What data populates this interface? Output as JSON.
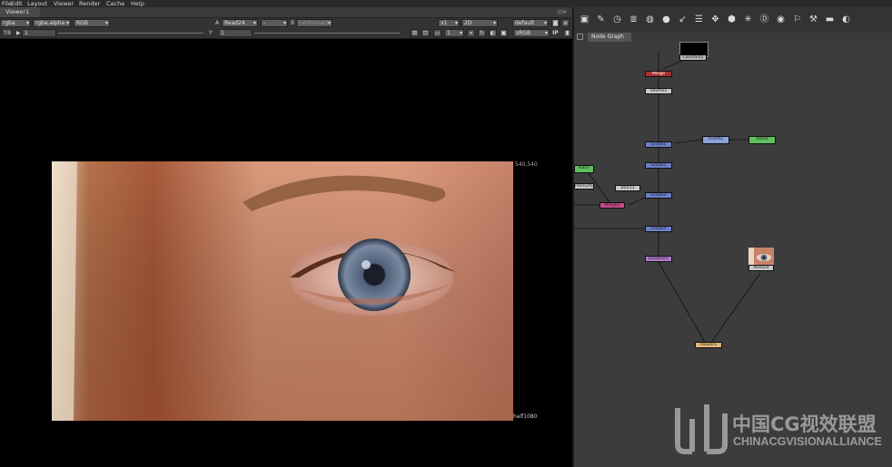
{
  "menu": {
    "items": [
      "File",
      "Edit",
      "Layout",
      "Viewer",
      "Render",
      "Cache",
      "Help"
    ]
  },
  "viewer": {
    "tab_label": "Viewer1",
    "channels_value": "rgba",
    "layer_value": "rgba.alpha",
    "display_channels_value": "RGB",
    "a_label": "A",
    "a_input_value": "Read24",
    "b_input_value": "-",
    "b_label": "B",
    "b_format_value": "(unformat)",
    "zoom_value": "x1",
    "view_mode_value": "2D",
    "lut_value": "default",
    "fstop_label": "f/8",
    "gain_value": "1",
    "y_label": "Y",
    "gamma_value": "1",
    "frame_value": "1",
    "colorspace_value": "sRGB",
    "ip_label": "IP",
    "format_top": "540,540",
    "format_bottom": "half1080"
  },
  "node_graph": {
    "tab_label": "Node Graph",
    "toolbar_icons": [
      "image-icon",
      "draw-icon",
      "time-icon",
      "channel-icon",
      "color-icon",
      "filter-icon",
      "keyer-icon",
      "merge-icon",
      "transform-icon",
      "3d-icon",
      "particles-icon",
      "deep-icon",
      "views-icon",
      "metadata-icon",
      "toolsets-icon",
      "other-icon",
      "furnace-icon"
    ],
    "nodes": [
      {
        "id": "constant",
        "label": "Constant2",
        "color": "#b8b8b8"
      },
      {
        "id": "merge_top",
        "label": "Merge",
        "color": "#a83232"
      },
      {
        "id": "shuffle",
        "label": "Shuffle5",
        "color": "#c8c8c8"
      },
      {
        "id": "grade1",
        "label": "Grade1",
        "color": "#6b7fc9"
      },
      {
        "id": "invert",
        "label": "Invert2",
        "color": "#8aa0d8"
      },
      {
        "id": "roto_right",
        "label": "Roto6",
        "color": "#5fbf5f"
      },
      {
        "id": "grade2",
        "label": "Grade2",
        "color": "#6b7fc9"
      },
      {
        "id": "roto_left",
        "label": "Roto7",
        "color": "#5fbf5f"
      },
      {
        "id": "premult",
        "label": "Premult1",
        "color": "#c8c8c8"
      },
      {
        "id": "merge_mid",
        "label": "Merge3",
        "color": "#c84a8a"
      },
      {
        "id": "blur_left",
        "label": "Blur13",
        "color": "#c8c8c8"
      },
      {
        "id": "grade3",
        "label": "Grade3",
        "color": "#6b7fc9"
      },
      {
        "id": "grade4",
        "label": "Grade4",
        "color": "#6b7fc9"
      },
      {
        "id": "dissolve",
        "label": "Dissolve1",
        "color": "#b07ac8"
      },
      {
        "id": "read",
        "label": "Read24",
        "color": "#c8c8c8"
      },
      {
        "id": "viewer_node",
        "label": "Viewer1",
        "color": "#e0b878"
      }
    ]
  },
  "watermark": {
    "chinese_text": "中国CG视效联盟",
    "english_text": "CHINACGVISIONALLIANCE"
  },
  "colors": {
    "panel_bg": "#333333",
    "node_graph_bg": "#3c3c3c",
    "viewer_bg": "#000000"
  }
}
